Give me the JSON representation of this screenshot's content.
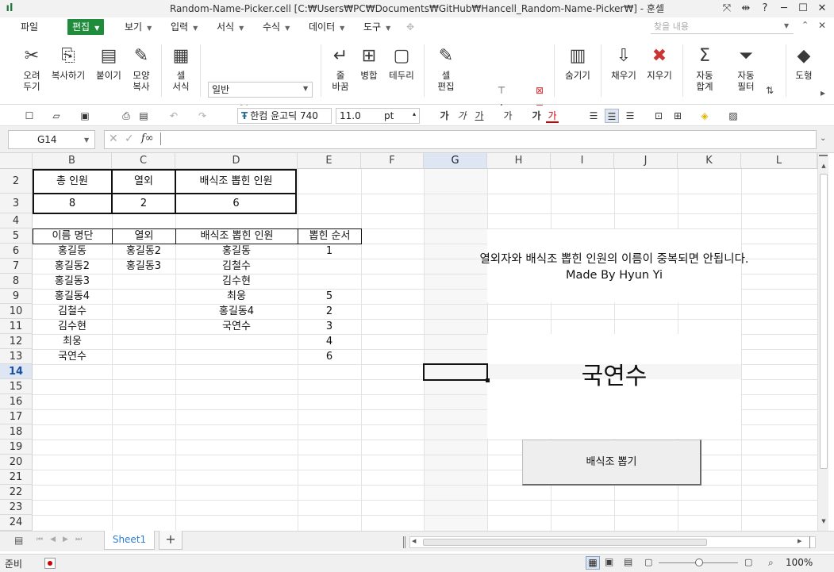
{
  "window": {
    "title": "Random-Name-Picker.cell [C:₩Users₩PC₩Documents₩GitHub₩Hancell_Random-Name-Picker₩] - 훈셀",
    "controls": [
      "⤧",
      "⇹",
      "?",
      "─",
      "☐",
      "✕"
    ]
  },
  "menu": {
    "items": [
      "파일",
      "편집",
      "보기",
      "입력",
      "서식",
      "수식",
      "데이터",
      "도구"
    ],
    "search_placeholder": "찾을 내용"
  },
  "ribbon": {
    "buttons": [
      {
        "label": "오려\n두기",
        "icon": "✂"
      },
      {
        "label": "복사하기",
        "icon": "⎘"
      },
      {
        "label": "붙이기",
        "icon": "📋"
      },
      {
        "label": "모양\n복사",
        "icon": "🖌"
      },
      {
        "label": "셀\n서식",
        "icon": "▦"
      },
      {
        "label": "줄\n바꿈",
        "icon": "↵"
      },
      {
        "label": "병합",
        "icon": "⊞"
      },
      {
        "label": "테두리",
        "icon": "▢"
      },
      {
        "label": "셀\n편집",
        "icon": "✎"
      },
      {
        "label": "숨기기",
        "icon": "▥"
      },
      {
        "label": "채우기",
        "icon": "⇩"
      },
      {
        "label": "지우기",
        "icon": "✖"
      },
      {
        "label": "자동\n합계",
        "icon": "Σ"
      },
      {
        "label": "자동\n필터",
        "icon": "⏷"
      },
      {
        "label": "도형",
        "icon": "◆"
      }
    ],
    "format_value": "일반"
  },
  "toolbar2": {
    "font": "한컴 윤고딕 740",
    "size": "11.0",
    "size_unit": "pt"
  },
  "formula": {
    "cell_ref": "G14",
    "fx": "f∞",
    "content": ""
  },
  "grid": {
    "columns": [
      "B",
      "C",
      "D",
      "E",
      "F",
      "G",
      "H",
      "I",
      "J",
      "K",
      "L"
    ],
    "selected_column": "G",
    "rows": [
      "2",
      "3",
      "4",
      "5",
      "6",
      "7",
      "8",
      "9",
      "10",
      "11",
      "12",
      "13",
      "14",
      "15",
      "16",
      "17",
      "18",
      "19",
      "20",
      "21",
      "22",
      "23",
      "24"
    ],
    "selected_row": "14",
    "summary_headers": [
      "총 인원",
      "열외",
      "배식조 뽑힌 인원"
    ],
    "summary_values": [
      "8",
      "2",
      "6"
    ],
    "list_headers": [
      "이름 명단",
      "열외",
      "배식조 뽑힌 인원",
      "뽑힌 순서"
    ],
    "names": [
      "홍길동",
      "홍길동2",
      "홍길동3",
      "홍길동4",
      "김철수",
      "김수현",
      "최웅",
      "국연수"
    ],
    "excluded": [
      "홍길동2",
      "홍길동3"
    ],
    "picked": [
      "홍길동",
      "김철수",
      "김수현",
      "최웅",
      "홍길동4",
      "국연수"
    ],
    "order": [
      "1",
      "",
      "",
      "5",
      "2",
      "3",
      "4",
      "6"
    ],
    "notice_line1": "열외자와 배식조 뽑힌 인원의 이름이 중복되면 안됩니다.",
    "notice_line2": "Made By Hyun Yi",
    "picked_name": "국연수",
    "pick_button": "배식조 뽑기"
  },
  "sheets": {
    "active": "Sheet1",
    "add": "+"
  },
  "status": {
    "mode": "준비",
    "zoom": "100%"
  },
  "colors": {
    "accent": "#1f8c3b",
    "selection": "#dde6f2",
    "tab_text": "#2f7bd6"
  }
}
